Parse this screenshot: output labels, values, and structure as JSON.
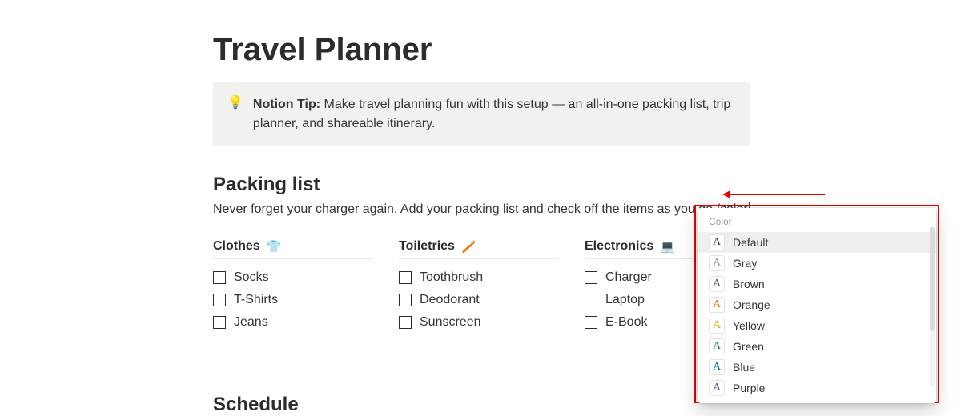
{
  "page": {
    "title": "Travel Planner"
  },
  "callout": {
    "icon": "💡",
    "label": "Notion Tip:",
    "body": "Make travel planning fun with this setup — an all-in-one packing list, trip planner, and shareable itinerary."
  },
  "packing": {
    "heading": "Packing list",
    "paragraph_pre": "Never forget your charger again. Add your packing list and check off the items as you ",
    "paragraph_link": "go.",
    "command_text": "/color",
    "columns": [
      {
        "title": "Clothes",
        "icon": "👕",
        "items": [
          "Socks",
          "T-Shirts",
          "Jeans"
        ]
      },
      {
        "title": "Toiletries",
        "icon": "🪥",
        "items": [
          "Toothbrush",
          "Deodorant",
          "Sunscreen"
        ]
      },
      {
        "title": "Electronics",
        "icon": "💻",
        "items": [
          "Charger",
          "Laptop",
          "E-Book"
        ]
      }
    ]
  },
  "schedule": {
    "heading": "Schedule"
  },
  "color_menu": {
    "title": "Color",
    "options": [
      {
        "label": "Default",
        "hex": "#37352f",
        "hovered": true
      },
      {
        "label": "Gray",
        "hex": "#9b9a97"
      },
      {
        "label": "Brown",
        "hex": "#64473a"
      },
      {
        "label": "Orange",
        "hex": "#d9730d"
      },
      {
        "label": "Yellow",
        "hex": "#dfab01"
      },
      {
        "label": "Green",
        "hex": "#0f7b6c"
      },
      {
        "label": "Blue",
        "hex": "#0b6e99"
      },
      {
        "label": "Purple",
        "hex": "#6940a5"
      }
    ]
  }
}
